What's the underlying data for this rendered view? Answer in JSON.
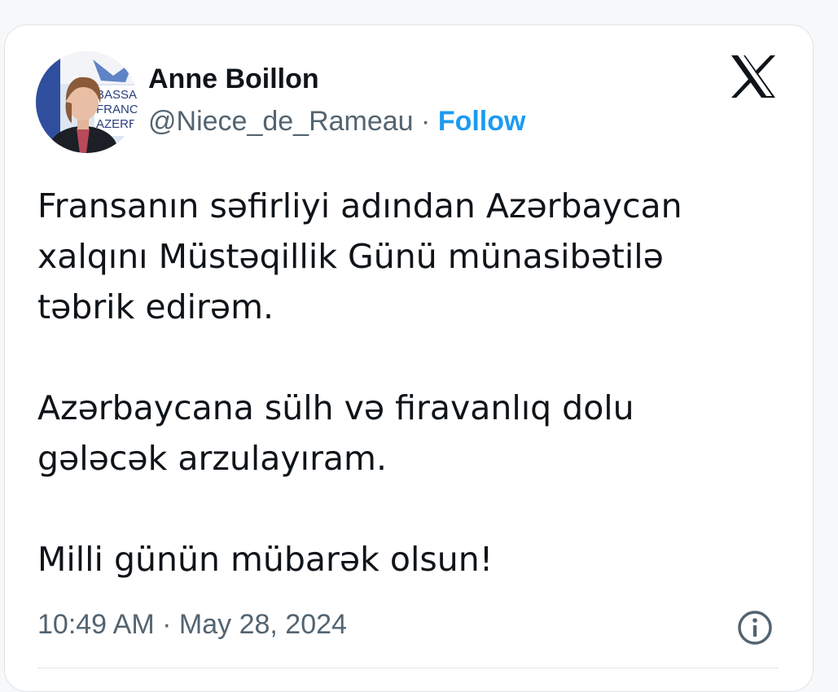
{
  "tweet": {
    "author": {
      "name": "Anne Boillon",
      "handle": "@Niece_de_Rameau",
      "separator": "·",
      "follow_label": "Follow"
    },
    "avatar_text_lines": [
      "BASSA",
      "FRANC",
      "AZERB"
    ],
    "paragraphs": [
      [
        "Fransanın səfirliyi adından Azərbaycan",
        "xalqını Müstəqillik Günü münasibətilə",
        "təbrik edirəm."
      ],
      [
        "Azərbaycana sülh və firavanlıq dolu",
        "gələcək arzulayıram."
      ],
      [
        "Milli günün mübarək olsun!"
      ]
    ],
    "time": "10:49 AM",
    "meta_separator": "·",
    "date": "May 28, 2024"
  },
  "icons": {
    "platform": "x-logo-icon",
    "info": "info-icon"
  },
  "colors": {
    "text": "#0f1419",
    "secondary": "#536471",
    "accent": "#1d9bf0"
  }
}
